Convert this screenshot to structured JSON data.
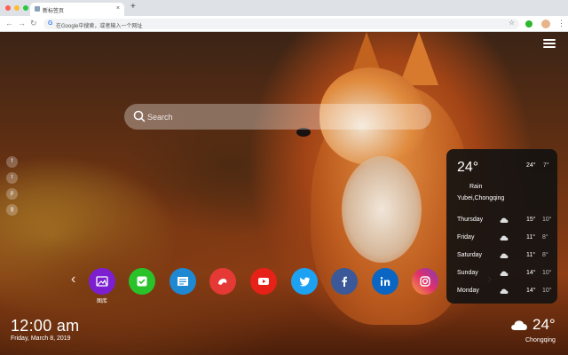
{
  "browser": {
    "tab_title": "新标签页",
    "tab_close": "×",
    "new_tab": "+",
    "address_placeholder": "在Google中搜索，或者输入一个网址",
    "google_glyph": "G"
  },
  "search": {
    "placeholder": "Search"
  },
  "social": [
    {
      "icon": "facebook-icon",
      "glyph": "f"
    },
    {
      "icon": "twitter-icon",
      "glyph": "t"
    },
    {
      "icon": "pinterest-icon",
      "glyph": "p"
    },
    {
      "icon": "google-plus-icon",
      "glyph": "g"
    }
  ],
  "app_bar": {
    "first_label": "图库",
    "apps": [
      {
        "name": "gallery",
        "color": "#7b1fd1"
      },
      {
        "name": "todo",
        "color": "#29c22a"
      },
      {
        "name": "news",
        "color": "#1e88d2"
      },
      {
        "name": "games",
        "color": "#e53935"
      },
      {
        "name": "youtube",
        "color": "#e62117"
      },
      {
        "name": "twitter",
        "color": "#1da1f2"
      },
      {
        "name": "facebook",
        "color": "#3b5998"
      },
      {
        "name": "linkedin",
        "color": "#0a66c2"
      },
      {
        "name": "instagram",
        "color": "#c13584"
      }
    ]
  },
  "clock": {
    "time": "12:00 am",
    "date": "Friday, March 8, 2019"
  },
  "weather": {
    "current_temp": "24°",
    "high": "24°",
    "low": "7°",
    "condition": "Rain",
    "location": "Yubei,Chongqing",
    "forecast": [
      {
        "day": "Thursday",
        "high": "15°",
        "low": "10°"
      },
      {
        "day": "Friday",
        "high": "11°",
        "low": "8°"
      },
      {
        "day": "Saturday",
        "high": "11°",
        "low": "8°"
      },
      {
        "day": "Sunday",
        "high": "14°",
        "low": "10°"
      },
      {
        "day": "Monday",
        "high": "14°",
        "low": "10°"
      }
    ],
    "bottom_temp": "24°",
    "bottom_location": "Chongqing"
  }
}
